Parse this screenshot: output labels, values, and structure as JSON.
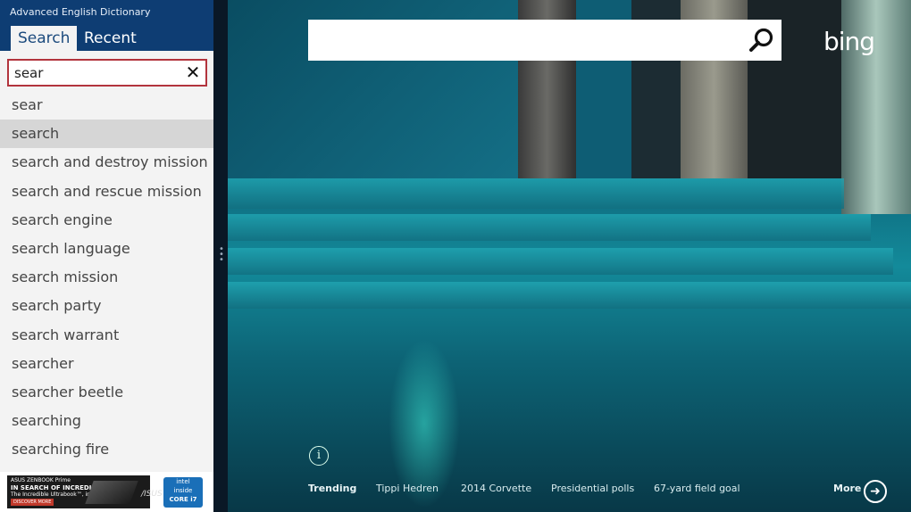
{
  "dictionary": {
    "app_title": "Advanced English Dictionary",
    "tabs": [
      {
        "label": "Search",
        "active": true
      },
      {
        "label": "Recent",
        "active": false
      }
    ],
    "search": {
      "value": "sear",
      "clear_icon": "close-icon"
    },
    "suggestions": [
      "sear",
      "search",
      "search and destroy mission",
      "search and rescue mission",
      "search engine",
      "search language",
      "search mission",
      "search party",
      "search warrant",
      "searcher",
      "searcher beetle",
      "searching",
      "searching fire"
    ],
    "selected_index": 1,
    "ad": {
      "line1": "ASUS ZENBOOK Prime",
      "line2": "IN SEARCH OF INCREDIBLE",
      "line3": "The Incredible Ultrabook™, inspired by Intel",
      "button": "DISCOVER MORE",
      "brand": "/ISUS",
      "badge_line1": "intel",
      "badge_line2": "inside",
      "badge_line3": "CORE i7"
    }
  },
  "bing": {
    "search_value": "",
    "search_icon": "search-icon",
    "logo": "bing",
    "info_icon": "info-icon",
    "trending_label": "Trending",
    "trending": [
      "Tippi Hedren",
      "2014 Corvette",
      "Presidential polls",
      "67-yard field goal"
    ],
    "more_label": "More",
    "more_icon": "arrow-right-circle-icon"
  },
  "colors": {
    "sidebar_header": "#0e3d73",
    "search_border": "#b2343d",
    "selected_row": "#d6d6d6",
    "bing_teal": "#138a9a"
  }
}
